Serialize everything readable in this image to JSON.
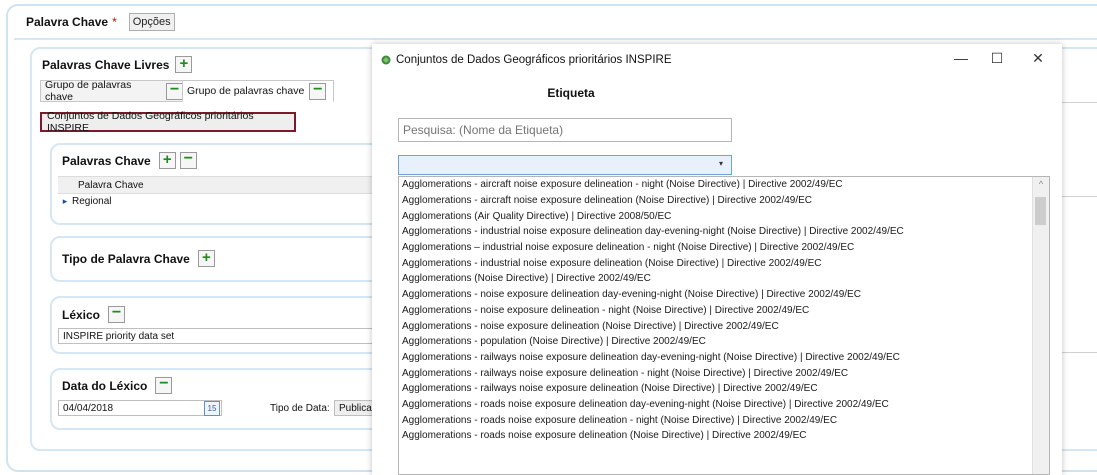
{
  "header": {
    "label": "Palavra Chave",
    "required": "*",
    "options_button": "Opções"
  },
  "free_keywords": {
    "title": "Palavras Chave Livres",
    "tabs": [
      "Grupo de palavras chave",
      "Grupo de palavras chave"
    ],
    "selected_tag": "Conjuntos de Dados Geográficos prioritários INSPIRE"
  },
  "keywords_section": {
    "title": "Palavras Chave",
    "column": "Palavra Chave",
    "rows": [
      "Regional"
    ]
  },
  "type_section": {
    "title": "Tipo de Palavra Chave"
  },
  "lexicon_section": {
    "title": "Léxico",
    "value": "INSPIRE priority data set"
  },
  "lexicon_date": {
    "title": "Data do Léxico",
    "date": "04/04/2018",
    "date_type_label": "Tipo de Data:",
    "date_type_value": "Publica"
  },
  "dialog": {
    "title": "Conjuntos de Dados Geográficos prioritários INSPIRE",
    "heading": "Etiqueta",
    "search_placeholder": "Pesquisa: (Nome da Etiqueta)",
    "items": [
      "Agglomerations - aircraft noise exposure delineation - night (Noise Directive) | Directive 2002/49/EC",
      "Agglomerations - aircraft noise exposure delineation (Noise Directive) | Directive 2002/49/EC",
      "Agglomerations (Air Quality Directive) | Directive 2008/50/EC",
      "Agglomerations - industrial noise exposure delineation day-evening-night (Noise Directive) | Directive 2002/49/EC",
      "Agglomerations – industrial noise exposure delineation - night (Noise Directive) | Directive 2002/49/EC",
      "Agglomerations - industrial noise exposure delineation (Noise Directive) | Directive 2002/49/EC",
      "Agglomerations (Noise Directive) | Directive 2002/49/EC",
      "Agglomerations - noise exposure delineation day-evening-night (Noise Directive) | Directive 2002/49/EC",
      "Agglomerations - noise exposure delineation - night (Noise Directive) | Directive 2002/49/EC",
      "Agglomerations - noise exposure delineation (Noise Directive) | Directive 2002/49/EC",
      "Agglomerations - population (Noise Directive) | Directive 2002/49/EC",
      "Agglomerations - railways noise exposure delineation day-evening-night (Noise Directive) | Directive 2002/49/EC",
      "Agglomerations - railways noise exposure delineation - night (Noise Directive) | Directive 2002/49/EC",
      "Agglomerations - railways noise exposure delineation (Noise Directive) | Directive 2002/49/EC",
      "Agglomerations - roads noise exposure delineation day-evening-night (Noise Directive) | Directive 2002/49/EC",
      "Agglomerations - roads noise exposure delineation - night (Noise Directive) | Directive 2002/49/EC",
      "Agglomerations - roads noise exposure delineation (Noise Directive) | Directive 2002/49/EC"
    ]
  },
  "icons": {
    "plus": "+",
    "minus": "−",
    "minimize": "—",
    "maximize": "☐",
    "close": "✕",
    "calendar": "15",
    "arrow": "▸",
    "dropdown": "▾"
  }
}
